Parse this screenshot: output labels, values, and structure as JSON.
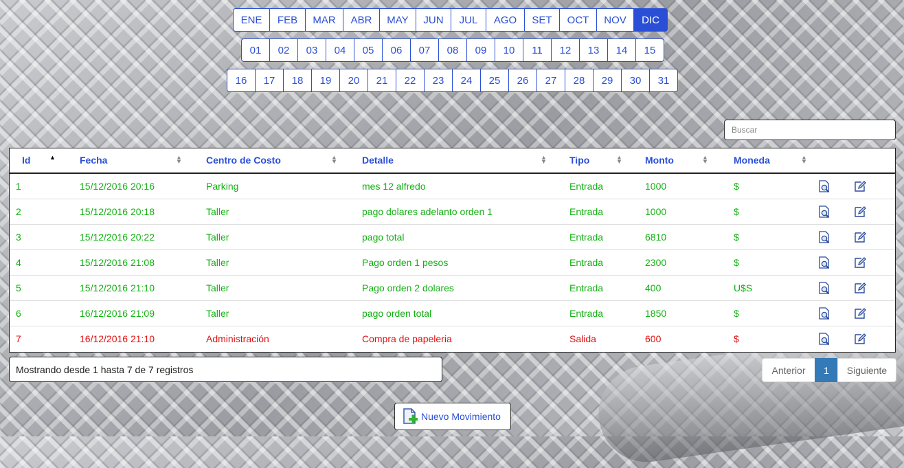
{
  "months": [
    "ENE",
    "FEB",
    "MAR",
    "ABR",
    "MAY",
    "JUN",
    "JUL",
    "AGO",
    "SET",
    "OCT",
    "NOV",
    "DIC"
  ],
  "selected_month": "DIC",
  "days_row1": [
    "01",
    "02",
    "03",
    "04",
    "05",
    "06",
    "07",
    "08",
    "09",
    "10",
    "11",
    "12",
    "13",
    "14",
    "15"
  ],
  "days_row2": [
    "16",
    "17",
    "18",
    "19",
    "20",
    "21",
    "22",
    "23",
    "24",
    "25",
    "26",
    "27",
    "28",
    "29",
    "30",
    "31"
  ],
  "search": {
    "placeholder": "Buscar",
    "value": ""
  },
  "table": {
    "headers": [
      "Id",
      "Fecha",
      "Centro de Costo",
      "Detalle",
      "Tipo",
      "Monto",
      "Moneda"
    ],
    "sorted_column": "Id",
    "rows": [
      {
        "id": "1",
        "fecha": "15/12/2016 20:16",
        "centro": "Parking",
        "detalle": "mes 12 alfredo",
        "tipo": "Entrada",
        "monto": "1000",
        "moneda": "$"
      },
      {
        "id": "2",
        "fecha": "15/12/2016 20:18",
        "centro": "Taller",
        "detalle": "pago dolares adelanto orden 1",
        "tipo": "Entrada",
        "monto": "1000",
        "moneda": "$"
      },
      {
        "id": "3",
        "fecha": "15/12/2016 20:22",
        "centro": "Taller",
        "detalle": "pago total",
        "tipo": "Entrada",
        "monto": "6810",
        "moneda": "$"
      },
      {
        "id": "4",
        "fecha": "15/12/2016 21:08",
        "centro": "Taller",
        "detalle": "Pago orden 1 pesos",
        "tipo": "Entrada",
        "monto": "2300",
        "moneda": "$"
      },
      {
        "id": "5",
        "fecha": "15/12/2016 21:10",
        "centro": "Taller",
        "detalle": "Pago orden 2 dolares",
        "tipo": "Entrada",
        "monto": "400",
        "moneda": "U$S"
      },
      {
        "id": "6",
        "fecha": "16/12/2016 21:09",
        "centro": "Taller",
        "detalle": "pago orden total",
        "tipo": "Entrada",
        "monto": "1850",
        "moneda": "$"
      },
      {
        "id": "7",
        "fecha": "16/12/2016 21:10",
        "centro": "Administración",
        "detalle": "Compra de papeleria",
        "tipo": "Salida",
        "monto": "600",
        "moneda": "$"
      }
    ]
  },
  "info_text": "Mostrando desde 1 hasta 7 de 7 registros",
  "pager": {
    "prev": "Anterior",
    "current": "1",
    "next": "Siguiente"
  },
  "new_button_label": "Nuevo Movimiento",
  "colors": {
    "accent": "#2a4fd6",
    "entrada": "#12b012",
    "salida": "#e01010",
    "pager_active": "#337ab7"
  }
}
